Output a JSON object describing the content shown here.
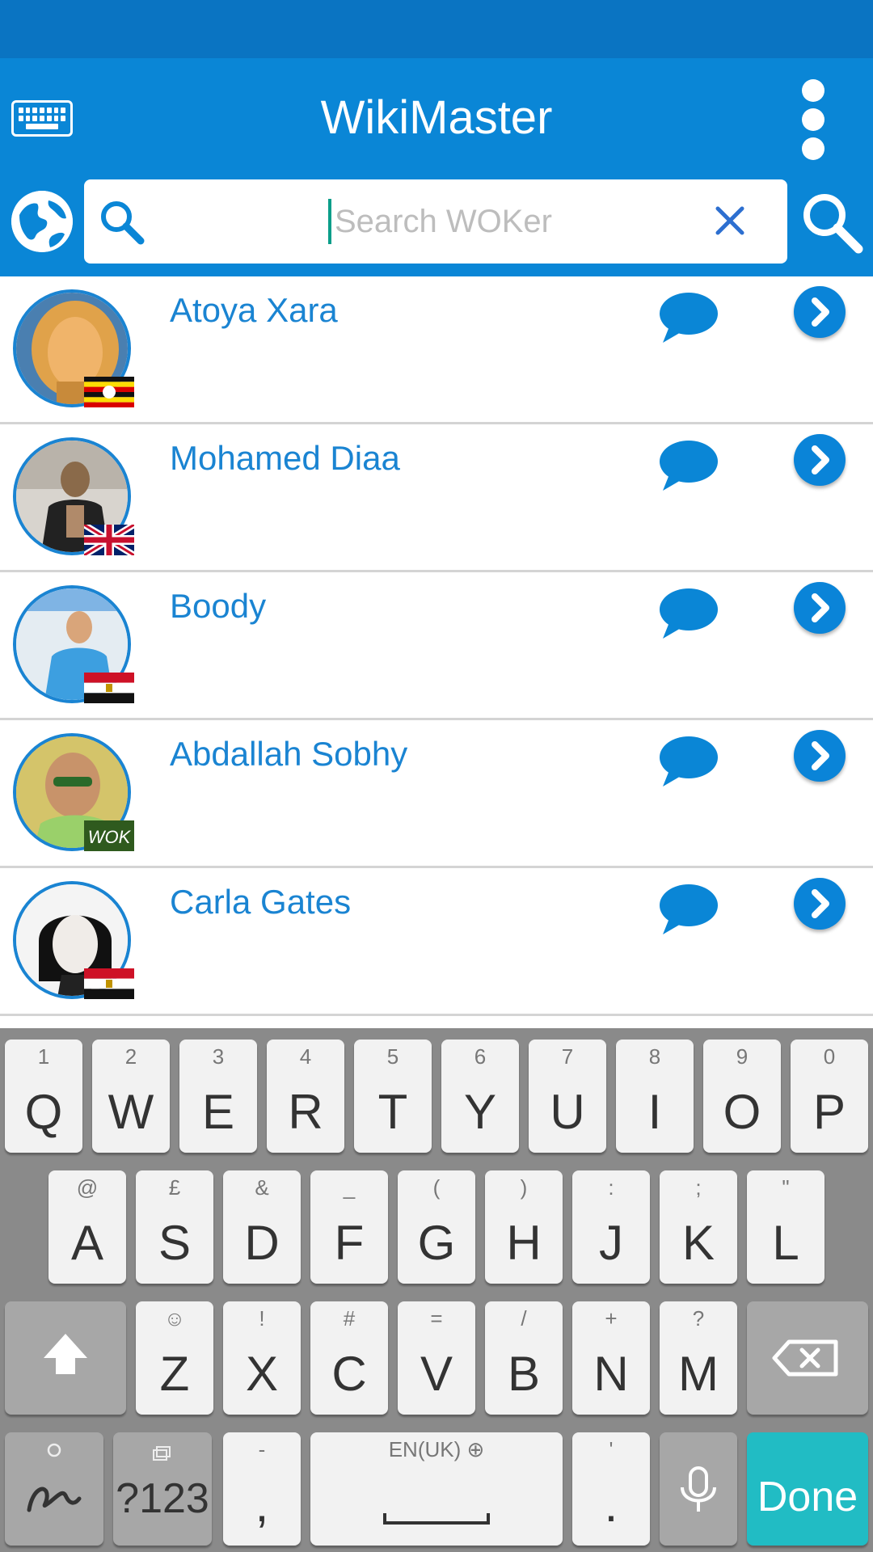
{
  "app": {
    "title": "WikiMaster",
    "accent_color": "#0a86d6",
    "statusbar_color": "#0a74c2"
  },
  "search": {
    "placeholder": "Search WOKer",
    "value": ""
  },
  "contacts": [
    {
      "name": "Atoya Xara",
      "flag": "uganda-flag"
    },
    {
      "name": "Mohamed Diaa",
      "flag": "uk-flag"
    },
    {
      "name": "Boody",
      "flag": "egypt-flag"
    },
    {
      "name": "Abdallah Sobhy",
      "flag": "wok-badge",
      "badge_text": "WOK"
    },
    {
      "name": "Carla Gates",
      "flag": "egypt-flag"
    }
  ],
  "keyboard": {
    "row1": [
      {
        "main": "Q",
        "sub": "1"
      },
      {
        "main": "W",
        "sub": "2"
      },
      {
        "main": "E",
        "sub": "3"
      },
      {
        "main": "R",
        "sub": "4"
      },
      {
        "main": "T",
        "sub": "5"
      },
      {
        "main": "Y",
        "sub": "6"
      },
      {
        "main": "U",
        "sub": "7"
      },
      {
        "main": "I",
        "sub": "8"
      },
      {
        "main": "O",
        "sub": "9"
      },
      {
        "main": "P",
        "sub": "0"
      }
    ],
    "row2": [
      {
        "main": "A",
        "sub": "@"
      },
      {
        "main": "S",
        "sub": "£"
      },
      {
        "main": "D",
        "sub": "&"
      },
      {
        "main": "F",
        "sub": "_"
      },
      {
        "main": "G",
        "sub": "("
      },
      {
        "main": "H",
        "sub": ")"
      },
      {
        "main": "J",
        "sub": ":"
      },
      {
        "main": "K",
        "sub": ";"
      },
      {
        "main": "L",
        "sub": "\""
      }
    ],
    "row3": [
      {
        "main": "Z",
        "sub": "☺"
      },
      {
        "main": "X",
        "sub": "!"
      },
      {
        "main": "C",
        "sub": "#"
      },
      {
        "main": "V",
        "sub": "="
      },
      {
        "main": "B",
        "sub": "/"
      },
      {
        "main": "N",
        "sub": "+"
      },
      {
        "main": "M",
        "sub": "?"
      }
    ],
    "symbols_label": "?123",
    "comma": {
      "main": ",",
      "sub": "-"
    },
    "space_label": "EN(UK) ⊕",
    "period": {
      "main": ".",
      "sub": "'"
    },
    "done_label": "Done"
  }
}
